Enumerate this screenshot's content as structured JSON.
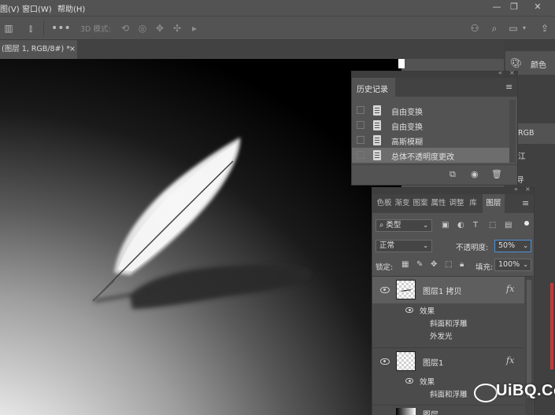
{
  "menu": {
    "items": [
      "图(V)",
      "窗口(W)",
      "帮助(H)"
    ]
  },
  "window_controls": [
    "minimize-icon",
    "restore-icon",
    "close-icon"
  ],
  "options_bar": {
    "mode_label": "3D 模式:"
  },
  "document_tab": {
    "title": "(图层 1, RGB/8#) *",
    "close": "×"
  },
  "right_dock": {
    "color_label": "颜色",
    "rgb_label": "RGB",
    "partial_1": "江",
    "partial_2": "导"
  },
  "history_panel": {
    "title": "历史记录",
    "items": [
      "自由变换",
      "自由变换",
      "高斯模糊",
      "总体不透明度更改"
    ]
  },
  "layers_panel": {
    "tabs": [
      "色板",
      "渐变",
      "图案",
      "属性",
      "调整",
      "库",
      "图层"
    ],
    "active_tab": "图层",
    "filter_label": "类型",
    "blend_mode": "正常",
    "opacity_label": "不透明度:",
    "opacity_value": "50%",
    "lock_label": "锁定:",
    "fill_label": "填充:",
    "fill_value": "100%",
    "layers": [
      {
        "name": "图层1 拷贝",
        "effects_label": "效果",
        "effects": [
          "斜面和浮雕",
          "外发光"
        ],
        "fx": "fx"
      },
      {
        "name": "图层1",
        "effects_label": "效果",
        "effects": [
          "斜面和浮雕"
        ],
        "fx": "fx"
      }
    ],
    "partial_bottom_layer": "图层"
  },
  "watermark": {
    "text": "UiBQ.CoM"
  },
  "colors": {
    "ui_bg": "#535353",
    "panel_dark": "#424242",
    "selected_row": "#6d6d6d",
    "accent_blue": "#4d90d8"
  }
}
